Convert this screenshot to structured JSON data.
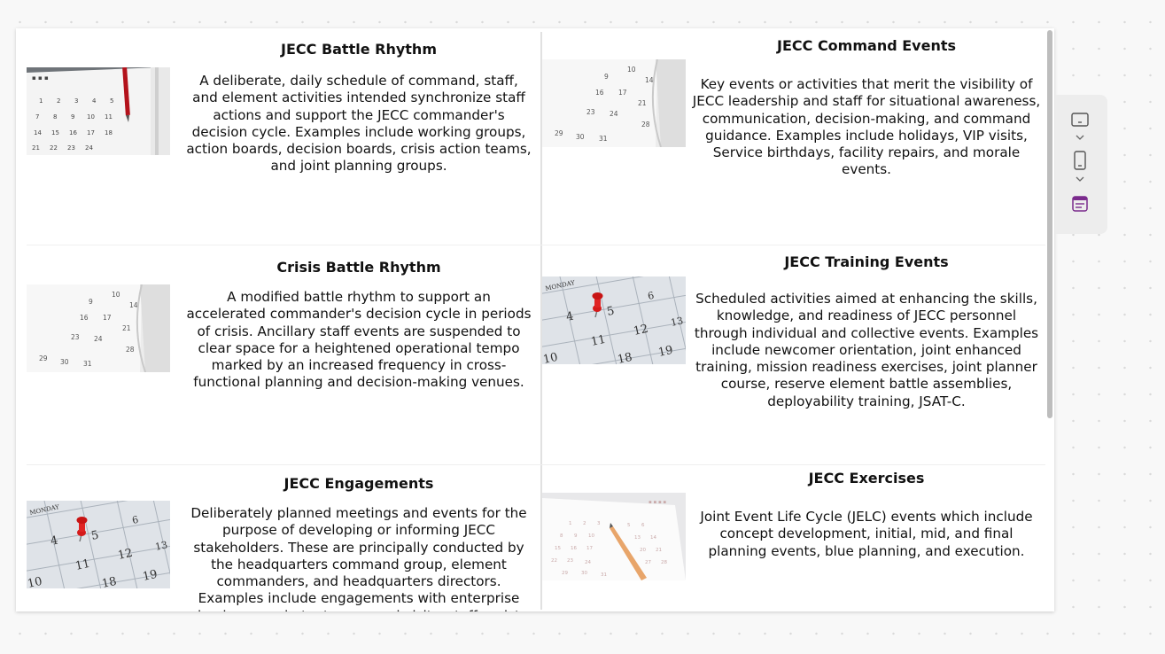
{
  "cards": [
    {
      "title": "JECC Battle Rhythm",
      "description": "A deliberate, daily schedule of command, staff, and element activities intended synchronize staff actions and support the JECC commander's decision cycle. Examples include working groups, action boards, decision boards, crisis action teams, and joint planning groups.",
      "image_icon": "calendar-pen-image"
    },
    {
      "title": "JECC Command Events",
      "description": "Key events or activities that merit the visibility of JECC leadership and staff for situational awareness, communication, decision-making, and command guidance. Examples include holidays, VIP visits, Service birthdays, facility repairs, and morale events.",
      "image_icon": "calendar-pages-image"
    },
    {
      "title": "Crisis Battle Rhythm",
      "description": "A modified battle rhythm to support an accelerated commander's decision cycle in periods of crisis. Ancillary staff events are suspended to clear space for a heightened operational tempo marked by an increased frequency in cross-functional planning and decision-making venues.",
      "image_icon": "calendar-pages-image"
    },
    {
      "title": "JECC Training Events",
      "description": "Scheduled activities aimed at enhancing the skills, knowledge, and readiness of JECC personnel through individual and collective events. Examples include newcomer orientation, joint enhanced training, mission readiness exercises, joint planner course, reserve element battle assemblies, deployability training, JSAT-C.",
      "image_icon": "calendar-pushpin-image"
    },
    {
      "title": "JECC Engagements",
      "description": "Deliberately planned meetings and events for the purpose of developing or informing JECC stakeholders. These are principally conducted by the headquarters command group, element commanders, and headquarters directors. Examples include engagements with enterprise leaders, combatant command visits, staff assist visits, and",
      "image_icon": "calendar-pushpin-image"
    },
    {
      "title": "JECC Exercises",
      "description": "Joint Event Life Cycle (JELC) events which include concept development, initial, mid, and final planning events, blue planning, and execution.",
      "image_icon": "calendar-pencil-image"
    }
  ],
  "calendar_labels": {
    "monday": "MONDAY",
    "numbers": [
      "4",
      "5",
      "6",
      "11",
      "12",
      "13",
      "18",
      "19",
      "10"
    ]
  },
  "toolbar": {
    "items": [
      "desktop-view-icon",
      "chevron-down-icon",
      "mobile-view-icon",
      "chevron-down-icon",
      "section-layout-icon"
    ],
    "accent_color": "#7a2a8c"
  }
}
